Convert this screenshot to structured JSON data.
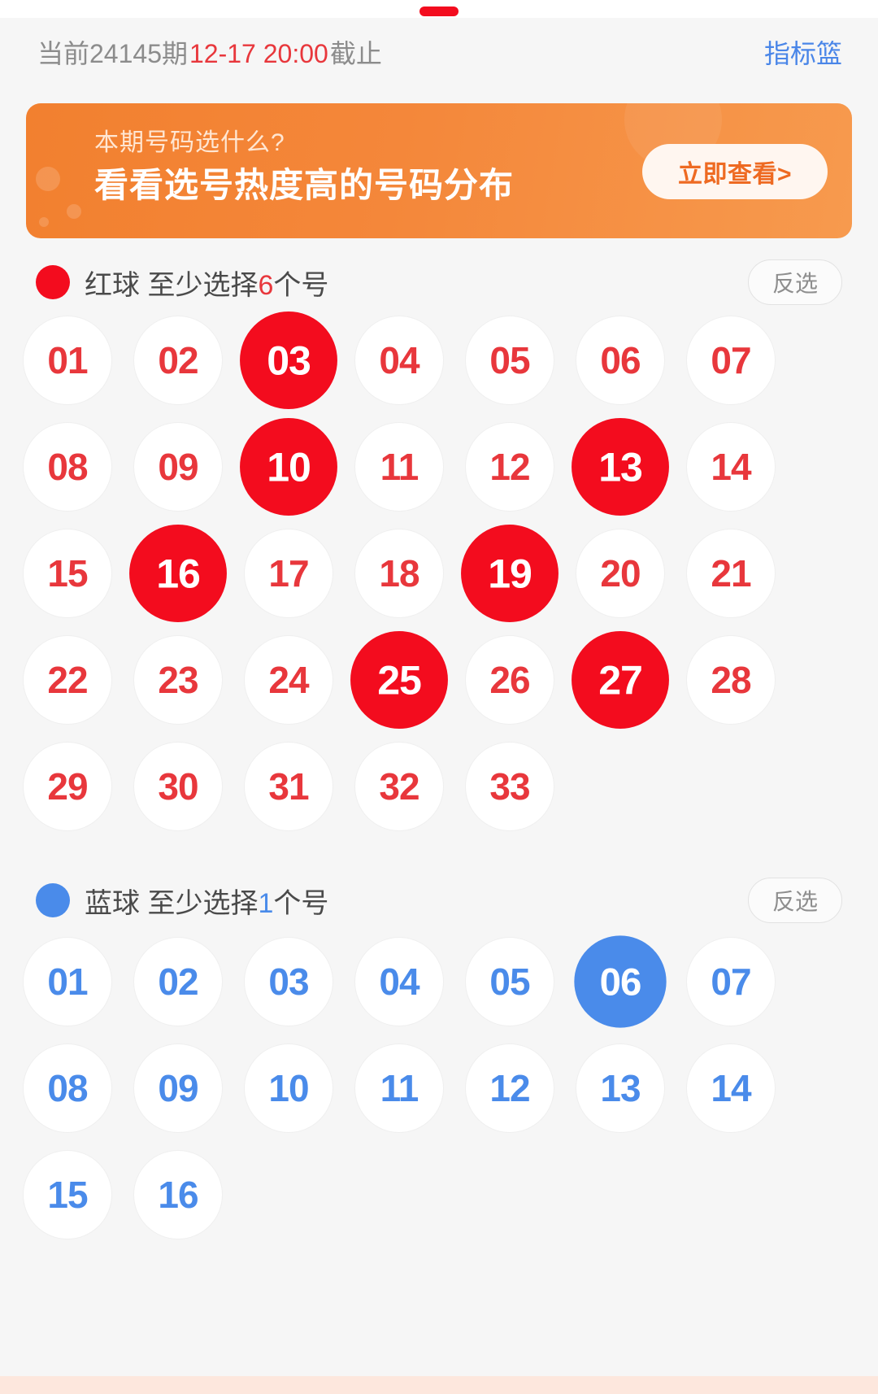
{
  "header": {
    "issue_prefix": "当前24145期",
    "deadline": "12-17 20:00",
    "issue_suffix": "截止",
    "basket_label": "指标篮"
  },
  "banner": {
    "subtitle": "本期号码选什么?",
    "title": "看看选号热度高的号码分布",
    "cta_label": "立即查看>",
    "bg_color": "#f2802f"
  },
  "red_section": {
    "dot_color": "#f30c1e",
    "label_prefix": "红球 至少选择",
    "min_count": "6",
    "label_suffix": "个号",
    "invert_label": "反选",
    "balls": [
      {
        "n": "01",
        "selected": false
      },
      {
        "n": "02",
        "selected": false
      },
      {
        "n": "03",
        "selected": true
      },
      {
        "n": "04",
        "selected": false
      },
      {
        "n": "05",
        "selected": false
      },
      {
        "n": "06",
        "selected": false
      },
      {
        "n": "07",
        "selected": false
      },
      {
        "n": "08",
        "selected": false
      },
      {
        "n": "09",
        "selected": false
      },
      {
        "n": "10",
        "selected": true
      },
      {
        "n": "11",
        "selected": false
      },
      {
        "n": "12",
        "selected": false
      },
      {
        "n": "13",
        "selected": true
      },
      {
        "n": "14",
        "selected": false
      },
      {
        "n": "15",
        "selected": false
      },
      {
        "n": "16",
        "selected": true
      },
      {
        "n": "17",
        "selected": false
      },
      {
        "n": "18",
        "selected": false
      },
      {
        "n": "19",
        "selected": true
      },
      {
        "n": "20",
        "selected": false
      },
      {
        "n": "21",
        "selected": false
      },
      {
        "n": "22",
        "selected": false
      },
      {
        "n": "23",
        "selected": false
      },
      {
        "n": "24",
        "selected": false
      },
      {
        "n": "25",
        "selected": true
      },
      {
        "n": "26",
        "selected": false
      },
      {
        "n": "27",
        "selected": true
      },
      {
        "n": "28",
        "selected": false
      },
      {
        "n": "29",
        "selected": false
      },
      {
        "n": "30",
        "selected": false
      },
      {
        "n": "31",
        "selected": false
      },
      {
        "n": "32",
        "selected": false
      },
      {
        "n": "33",
        "selected": false
      }
    ],
    "selected_numbers": [
      "03",
      "10",
      "13",
      "16",
      "19",
      "25",
      "27"
    ]
  },
  "blue_section": {
    "dot_color": "#4a8bea",
    "label_prefix": "蓝球 至少选择",
    "min_count": "1",
    "label_suffix": "个号",
    "invert_label": "反选",
    "balls": [
      {
        "n": "01",
        "selected": false
      },
      {
        "n": "02",
        "selected": false
      },
      {
        "n": "03",
        "selected": false
      },
      {
        "n": "04",
        "selected": false
      },
      {
        "n": "05",
        "selected": false
      },
      {
        "n": "06",
        "selected": true
      },
      {
        "n": "07",
        "selected": false
      },
      {
        "n": "08",
        "selected": false
      },
      {
        "n": "09",
        "selected": false
      },
      {
        "n": "10",
        "selected": false
      },
      {
        "n": "11",
        "selected": false
      },
      {
        "n": "12",
        "selected": false
      },
      {
        "n": "13",
        "selected": false
      },
      {
        "n": "14",
        "selected": false
      },
      {
        "n": "15",
        "selected": false
      },
      {
        "n": "16",
        "selected": false
      }
    ],
    "selected_numbers": [
      "06"
    ]
  }
}
